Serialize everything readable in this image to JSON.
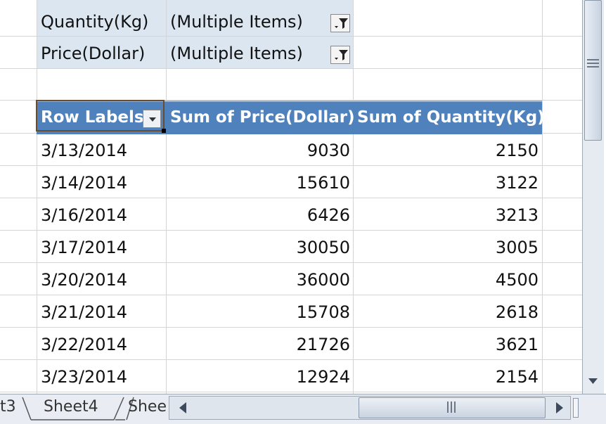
{
  "filters": [
    {
      "field": "Quantity(Kg)",
      "value": "(Multiple Items)"
    },
    {
      "field": "Price(Dollar)",
      "value": "(Multiple Items)"
    }
  ],
  "pivot": {
    "headers": [
      "Row Labels",
      "Sum of Price(Dollar)",
      "Sum of Quantity(Kg)"
    ],
    "rows": [
      [
        "3/13/2014",
        "9030",
        "2150"
      ],
      [
        "3/14/2014",
        "15610",
        "3122"
      ],
      [
        "3/16/2014",
        "6426",
        "3213"
      ],
      [
        "3/17/2014",
        "30050",
        "3005"
      ],
      [
        "3/20/2014",
        "36000",
        "4500"
      ],
      [
        "3/21/2014",
        "15708",
        "2618"
      ],
      [
        "3/22/2014",
        "21726",
        "3621"
      ],
      [
        "3/23/2014",
        "12924",
        "2154"
      ]
    ]
  },
  "sheet_tabs": [
    "t3",
    "Sheet4",
    "Shee"
  ],
  "icons": {
    "filter_button": "filter-funnel-icon",
    "header_dropdown": "dropdown-arrow-icon",
    "scroll_down": "arrow-down-icon",
    "scroll_left": "arrow-left-icon",
    "scroll_right": "arrow-right-icon"
  },
  "colors": {
    "header_bg": "#4f81bd",
    "filter_area_bg": "#dce6f1",
    "gridline": "#d4d4d4"
  }
}
